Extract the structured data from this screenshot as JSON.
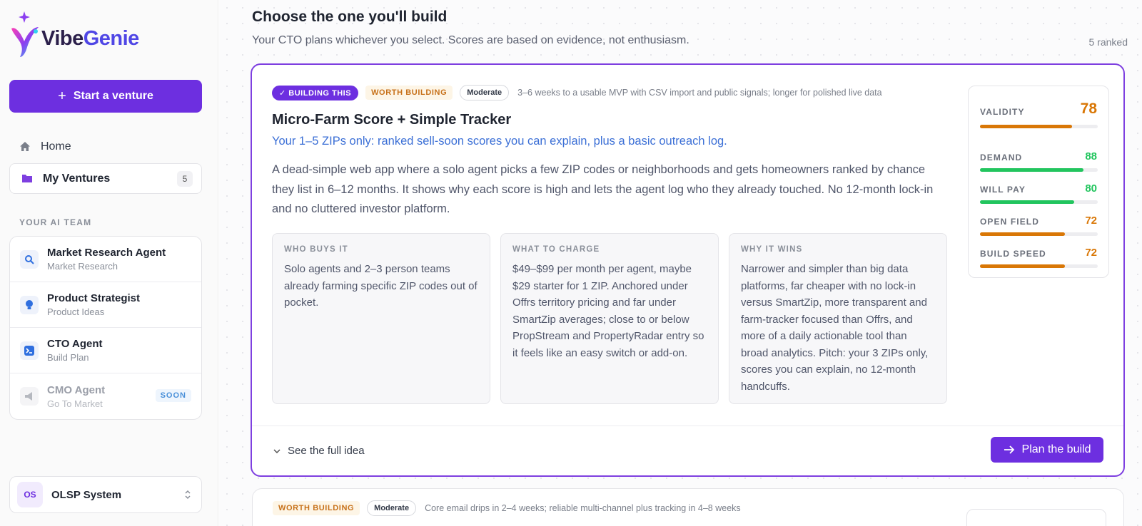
{
  "brand": {
    "name_part1": "Vibe",
    "name_part2": "Genie"
  },
  "sidebar": {
    "start_label": "Start a venture",
    "home_label": "Home",
    "ventures_label": "My Ventures",
    "ventures_count": "5",
    "team_heading": "YOUR AI TEAM",
    "agents": [
      {
        "name": "Market Research Agent",
        "sub": "Market Research",
        "icon": "search-icon"
      },
      {
        "name": "Product Strategist",
        "sub": "Product Ideas",
        "icon": "lightbulb-icon"
      },
      {
        "name": "CTO Agent",
        "sub": "Build Plan",
        "icon": "terminal-icon"
      },
      {
        "name": "CMO Agent",
        "sub": "Go To Market",
        "icon": "megaphone-icon",
        "badge": "SOON"
      }
    ],
    "workspace": {
      "initials": "OS",
      "name": "OLSP System"
    }
  },
  "main": {
    "title": "Choose the one you'll build",
    "subtitle": "Your CTO plans whichever you select. Scores are based on evidence, not enthusiasm.",
    "ranked": "5 ranked",
    "cards": [
      {
        "building_tag": "BUILDING THIS",
        "verdict": "WORTH BUILDING",
        "difficulty": "Moderate",
        "timeline": "3–6 weeks to a usable MVP with CSV import and public signals; longer for polished live data",
        "title": "Micro-Farm Score + Simple Tracker",
        "tagline": "Your 1–5 ZIPs only: ranked sell-soon scores you can explain, plus a basic outreach log.",
        "description": "A dead-simple web app where a solo agent picks a few ZIP codes or neighborhoods and gets homeowners ranked by chance they list in 6–12 months. It shows why each score is high and lets the agent log who they already touched. No 12-month lock-in and no cluttered investor platform.",
        "boxes": [
          {
            "head": "WHO BUYS IT",
            "body": "Solo agents and 2–3 person teams already farming specific ZIP codes out of pocket."
          },
          {
            "head": "WHAT TO CHARGE",
            "body": "$49–$99 per month per agent, maybe $29 starter for 1 ZIP. Anchored under Offrs territory pricing and far under SmartZip averages; close to or below PropStream and PropertyRadar entry so it feels like an easy switch or add-on."
          },
          {
            "head": "WHY IT WINS",
            "body": "Narrower and simpler than big data platforms, far cheaper with no lock-in versus SmartZip, more transparent and farm-tracker focused than Offrs, and more of a daily actionable tool than broad analytics. Pitch: your 3 ZIPs only, scores you can explain, no 12-month handcuffs."
          }
        ],
        "scores": [
          {
            "label": "VALIDITY",
            "value": 78,
            "color": "#d97706"
          },
          {
            "label": "DEMAND",
            "value": 88,
            "color": "#22c55e"
          },
          {
            "label": "WILL PAY",
            "value": 80,
            "color": "#22c55e"
          },
          {
            "label": "OPEN FIELD",
            "value": 72,
            "color": "#d97706"
          },
          {
            "label": "BUILD SPEED",
            "value": 72,
            "color": "#d97706"
          }
        ],
        "see_full": "See the full idea",
        "plan_label": "Plan the build"
      },
      {
        "verdict": "WORTH BUILDING",
        "difficulty": "Moderate",
        "timeline": "Core email drips in 2–4 weeks; reliable multi-channel plus tracking in 4–8 weeks"
      }
    ]
  }
}
